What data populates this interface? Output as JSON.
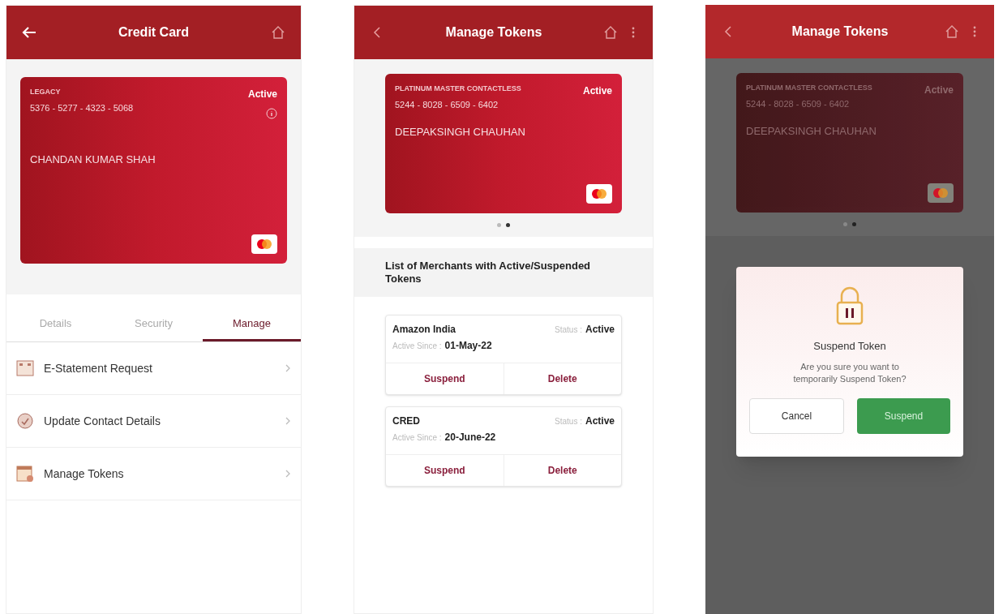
{
  "screens": [
    {
      "kind": "card_detail",
      "dimmed": false,
      "header": {
        "title": "Credit Card"
      },
      "card": {
        "type": "LEGACY",
        "status": "Active",
        "number": "5376 - 5277 - 4323 - 5068",
        "holder": "CHANDAN KUMAR SHAH"
      },
      "tabs": [
        {
          "label": "Details",
          "selected": false
        },
        {
          "label": "Security",
          "selected": false
        },
        {
          "label": "Manage",
          "selected": true
        }
      ],
      "menu": [
        {
          "label": "E-Statement Request",
          "kind": "statement"
        },
        {
          "label": "Update Contact Details",
          "kind": "contact"
        },
        {
          "label": "Manage Tokens",
          "kind": "tokens"
        }
      ]
    },
    {
      "kind": "token_list",
      "dimmed": false,
      "header": {
        "title": "Manage Tokens"
      },
      "card": {
        "type": "PLATINUM MASTER CONTACTLESS",
        "status": "Active",
        "number": "5244 - 8028 - 6509 - 6402",
        "holder": "DEEPAKSINGH CHAUHAN"
      },
      "pager": [
        {
          "selected": false
        },
        {
          "selected": true
        }
      ],
      "section_title": "List of Merchants with Active/Suspended Tokens",
      "tokens": [
        {
          "merchant": "Amazon India",
          "status_label": "Status :",
          "status": "Active",
          "since_label": "Active Since :",
          "since": "01-May-22",
          "actions": [
            "Suspend",
            "Delete"
          ]
        },
        {
          "merchant": "CRED",
          "status_label": "Status :",
          "status": "Active",
          "since_label": "Active Since :",
          "since": "20-June-22",
          "actions": [
            "Suspend",
            "Delete"
          ]
        }
      ]
    },
    {
      "kind": "token_dialog",
      "dimmed": true,
      "header": {
        "title": "Manage Tokens"
      },
      "card": {
        "type": "PLATINUM MASTER CONTACTLESS",
        "status": "Active",
        "number": "5244 - 8028 - 6509 - 6402",
        "holder": "DEEPAKSINGH CHAUHAN"
      },
      "pager": [
        {
          "selected": false
        },
        {
          "selected": true
        }
      ],
      "dialog": {
        "title": "Suspend Token",
        "message": "Are you sure you want to temporarily Suspend Token?",
        "buttons": [
          {
            "label": "Cancel",
            "kind": "secondary"
          },
          {
            "label": "Suspend",
            "kind": "primary"
          }
        ]
      }
    }
  ]
}
